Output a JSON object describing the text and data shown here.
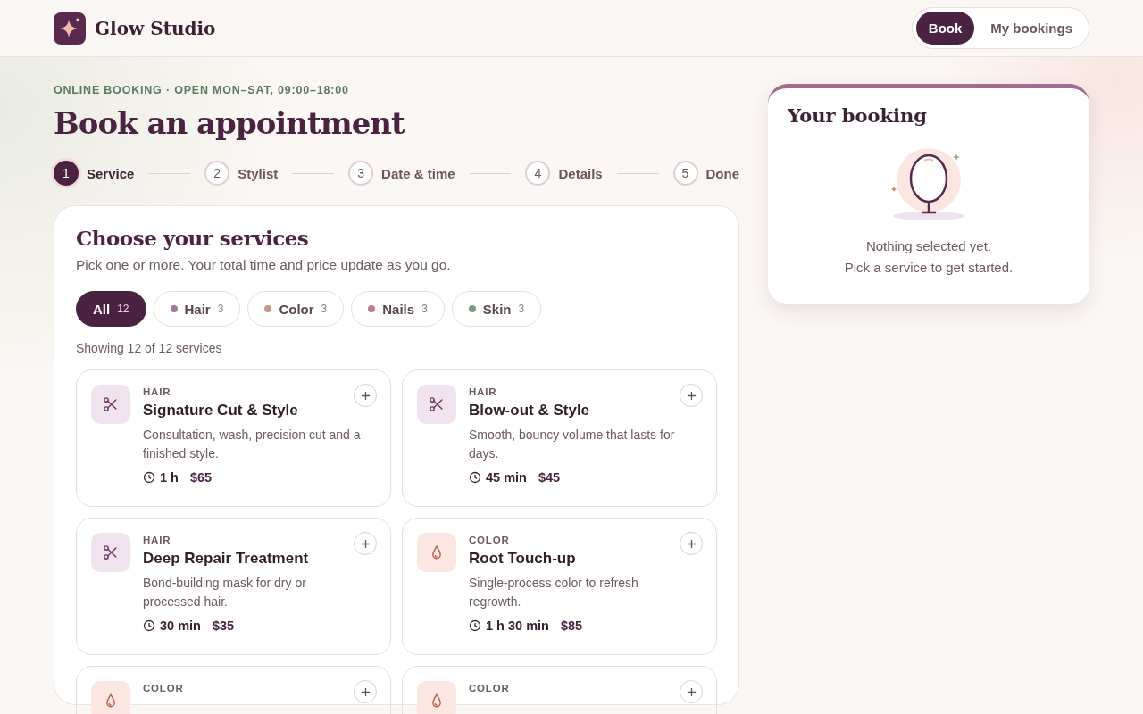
{
  "brand": {
    "name": "Glow Studio"
  },
  "nav": [
    {
      "label": "Book",
      "selected": true
    },
    {
      "label": "My bookings",
      "selected": false
    }
  ],
  "eyebrow": "ONLINE BOOKING · OPEN MON–SAT, 09:00–18:00",
  "title": "Book an appointment",
  "steps": [
    {
      "number": "1",
      "label": "Service",
      "selected": true
    },
    {
      "number": "2",
      "label": "Stylist",
      "selected": false
    },
    {
      "number": "3",
      "label": "Date & time",
      "selected": false
    },
    {
      "number": "4",
      "label": "Details",
      "selected": false
    },
    {
      "number": "5",
      "label": "Done",
      "selected": false
    }
  ],
  "services_panel": {
    "title": "Choose your services",
    "subtitle": "Pick one or more. Your total time and price update as you go.",
    "filters": [
      {
        "label": "All",
        "count": "12",
        "selected": true
      },
      {
        "label": "Hair",
        "count": "3",
        "selected": false,
        "color": "#a07a98"
      },
      {
        "label": "Color",
        "count": "3",
        "selected": false,
        "color": "#c99580"
      },
      {
        "label": "Nails",
        "count": "3",
        "selected": false,
        "color": "#c07a96"
      },
      {
        "label": "Skin",
        "count": "3",
        "selected": false,
        "color": "#7f9a84"
      }
    ],
    "showing": "Showing 12 of 12 services",
    "services": [
      {
        "kind": "hair",
        "category": "HAIR",
        "name": "Signature Cut & Style",
        "description": "Consultation, wash, precision cut and a finished style.",
        "duration": "1 h",
        "price": "$65"
      },
      {
        "kind": "hair",
        "category": "HAIR",
        "name": "Blow-out & Style",
        "description": "Smooth, bouncy volume that lasts for days.",
        "duration": "45 min",
        "price": "$45"
      },
      {
        "kind": "hair",
        "category": "HAIR",
        "name": "Deep Repair Treatment",
        "description": "Bond-building mask for dry or processed hair.",
        "duration": "30 min",
        "price": "$35"
      },
      {
        "kind": "color",
        "category": "COLOR",
        "name": "Root Touch-up",
        "description": "Single-process color to refresh regrowth.",
        "duration": "1 h 30 min",
        "price": "$85"
      },
      {
        "kind": "color",
        "category": "COLOR"
      },
      {
        "kind": "color",
        "category": "COLOR"
      }
    ]
  },
  "booking": {
    "title": "Your booking",
    "empty_lines": [
      "Nothing selected yet.",
      "Pick a service to get started."
    ]
  }
}
